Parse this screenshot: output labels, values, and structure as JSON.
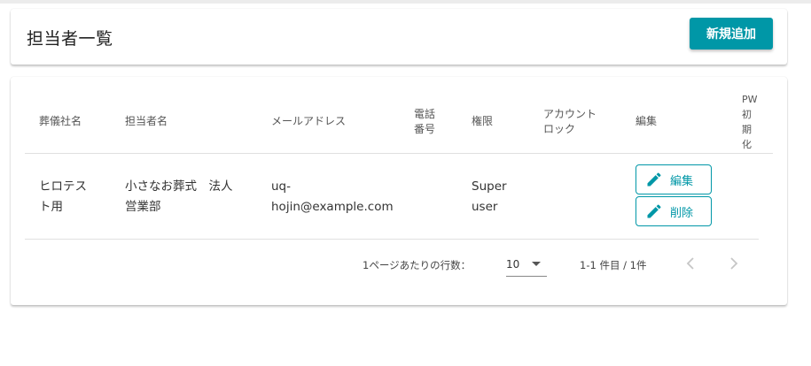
{
  "header": {
    "title": "担当者一覧",
    "add_button": "新規追加"
  },
  "table": {
    "columns": [
      "葬儀社名",
      "担当者名",
      "メールアドレス",
      "電話\n番号",
      "権限",
      "アカウント\nロック",
      "編集",
      "PW\n初\n期\n化"
    ],
    "rows": [
      {
        "company": "ヒロテス\nト用",
        "person": "小さなお葬式　法人\n営業部",
        "email": "uq-\nhojin@example.com",
        "phone": "",
        "role": "Super\nuser",
        "lock": "",
        "edit_label": "編集",
        "delete_label": "削除"
      }
    ]
  },
  "pagination": {
    "rows_per_page_label": "1ページあたりの行数：",
    "rows_per_page_value": "10",
    "range_text": "1-1 件目 / 1件"
  },
  "colors": {
    "accent": "#0097a7"
  },
  "icons": [
    "pencil-icon",
    "chevron-down-icon",
    "chevron-left-icon",
    "chevron-right-icon"
  ]
}
